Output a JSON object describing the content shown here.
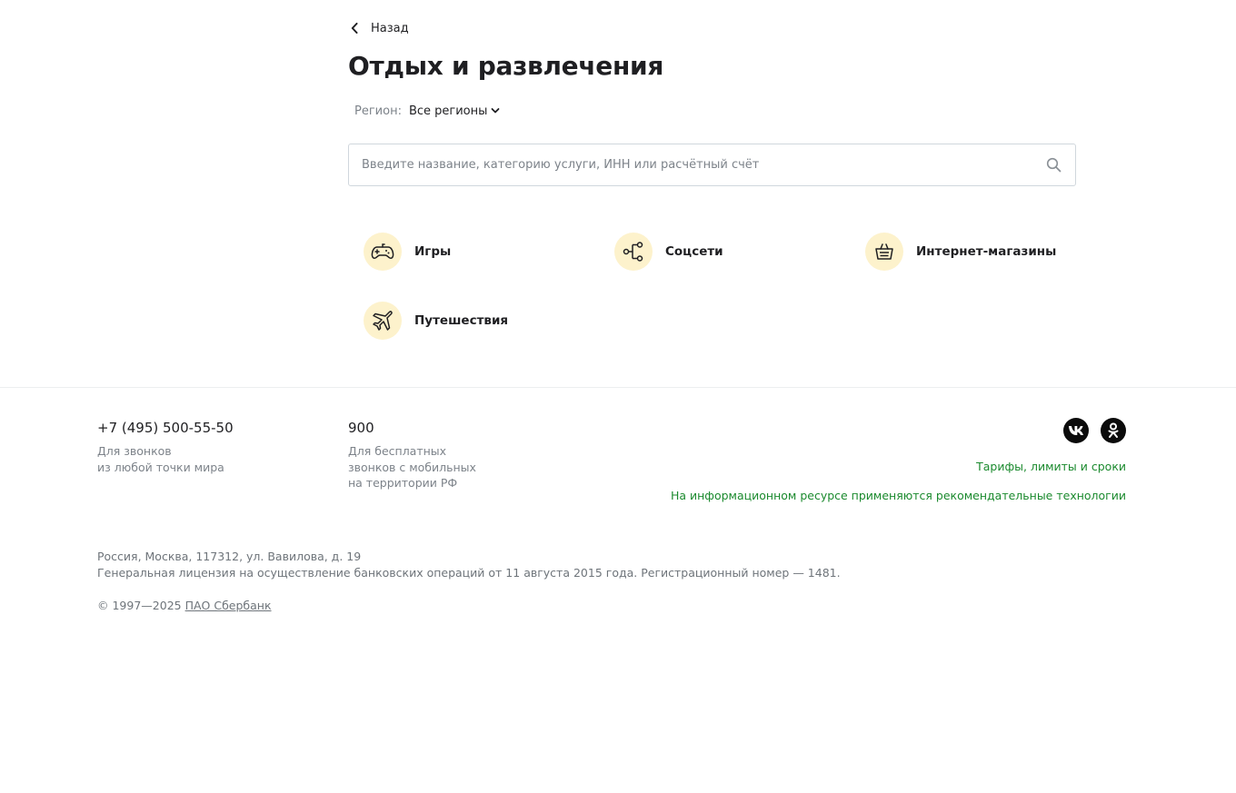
{
  "nav": {
    "back_label": "Назад"
  },
  "page": {
    "title": "Отдых и развлечения"
  },
  "region": {
    "label": "Регион:",
    "value": "Все регионы"
  },
  "search": {
    "placeholder": "Введите название, категорию услуги, ИНН или расчётный счёт"
  },
  "categories": [
    {
      "label": "Игры",
      "icon": "gamepad-icon"
    },
    {
      "label": "Соцсети",
      "icon": "share-icon"
    },
    {
      "label": "Интернет-магазины",
      "icon": "basket-icon"
    },
    {
      "label": "Путешествия",
      "icon": "airplane-icon"
    }
  ],
  "footer": {
    "phone1": {
      "number": "+7 (495) 500-55-50",
      "desc1": "Для звонков",
      "desc2": "из любой точки мира"
    },
    "phone2": {
      "number": "900",
      "desc1": "Для бесплатных",
      "desc2": "звонков с мобильных",
      "desc3": "на территории РФ"
    },
    "social": [
      "vk-icon",
      "odnoklassniki-icon"
    ],
    "links": {
      "tariffs": "Тарифы, лимиты и сроки",
      "recommend": "На информационном ресурсе применяются рекомендательные технологии"
    },
    "address": "Россия, Москва, 117312, ул. Вавилова, д. 19",
    "license": "Генеральная лицензия на осуществление банковских операций от 11 августа 2015 года. Регистрационный номер — 1481.",
    "copyright_prefix": "© 1997—2025",
    "copyright_link": "ПАО Сбербанк"
  },
  "colors": {
    "accent_green": "#1b8a2e",
    "icon_bg": "#fdf2cc",
    "text_dark": "#1f1f22",
    "text_gray": "#7d838a"
  }
}
